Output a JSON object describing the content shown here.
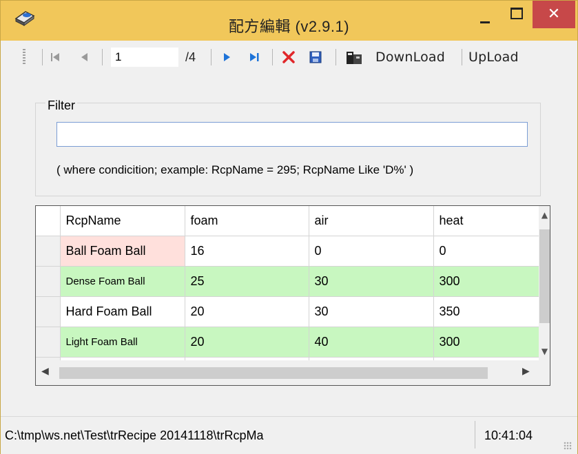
{
  "window": {
    "title": "配方編輯 (v2.9.1)",
    "close_label": "✕"
  },
  "toolbar": {
    "position_value": "1",
    "count_label": "/4",
    "download_label": "DownLoad",
    "upload_label": "UpLoad"
  },
  "filter": {
    "legend": "Filter",
    "value": "",
    "hint": "( where condicition; example: RcpName = 295;  RcpName Like 'D%' )"
  },
  "grid": {
    "columns": [
      "RcpName",
      "foam",
      "air",
      "heat"
    ],
    "rows": [
      {
        "name": "Ball Foam Ball",
        "foam": "16",
        "air": "0",
        "heat": "0"
      },
      {
        "name": "Dense Foam Ball",
        "foam": "25",
        "air": "30",
        "heat": "300"
      },
      {
        "name": "Hard Foam Ball",
        "foam": "20",
        "air": "30",
        "heat": "350"
      },
      {
        "name": "Light Foam Ball",
        "foam": "20",
        "air": "40",
        "heat": "300"
      }
    ]
  },
  "status": {
    "path": "C:\\tmp\\ws.net\\Test\\trRecipe 20141118\\trRcpMa",
    "time": "10:41:04"
  },
  "colors": {
    "titlebar": "#f1c75a",
    "close_button": "#c74849",
    "alt_row": "#c8f7c0",
    "selected_cell": "#ffe0dc"
  }
}
